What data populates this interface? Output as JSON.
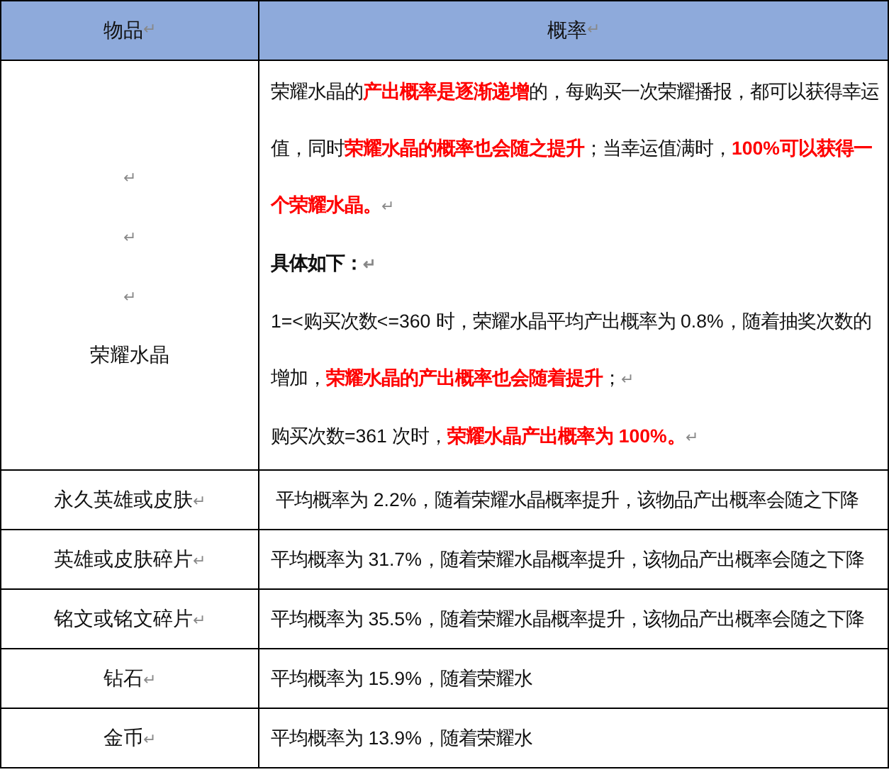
{
  "table": {
    "columns": [
      {
        "label": "物品",
        "end_mark": "↵"
      },
      {
        "label": "概率",
        "end_mark": "↵"
      }
    ],
    "rows": [
      {
        "item": [
          {
            "end_mark": "↵"
          },
          {
            "end_mark": "↵"
          },
          {
            "end_mark": "↵"
          },
          {
            "text": "荣耀水晶"
          }
        ],
        "probability": [
          {
            "text": "荣耀水晶的**产出概率是逐渐递增**的，每购买一次荣耀播报，都可以获得幸运值，同时**荣耀水晶的概率也会随之提升**；当幸运值满时，**100%可以获得一个荣耀水晶。**",
            "end_mark": "↵"
          },
          {
            "text": "具体如下：",
            "bold": true,
            "end_mark": "↵"
          },
          {
            "text": "1=<购买次数<=360 时，荣耀水晶平均产出概率为 0.8%，随着抽奖次数的增加，**荣耀水晶的产出概率也会随着提升**；",
            "end_mark": "↵"
          },
          {
            "text": "购买次数=361 次时，**荣耀水晶产出概率为 100%。**",
            "end_mark": "↵"
          }
        ]
      },
      {
        "item": [
          {
            "text": "永久英雄或皮肤",
            "end_mark": "↵"
          }
        ],
        "probability": [
          {
            "text": " 平均概率为 2.2%，随着荣耀水晶概率提升，该物品产出概率会随之下降"
          }
        ]
      },
      {
        "item": [
          {
            "text": "英雄或皮肤碎片",
            "end_mark": "↵"
          }
        ],
        "probability": [
          {
            "text": "平均概率为 31.7%，随着荣耀水晶概率提升，该物品产出概率会随之下降"
          }
        ]
      },
      {
        "item": [
          {
            "text": "铭文或铭文碎片",
            "end_mark": "↵"
          }
        ],
        "probability": [
          {
            "text": "平均概率为 35.5%，随着荣耀水晶概率提升，该物品产出概率会随之下降"
          }
        ]
      },
      {
        "item": [
          {
            "text": "钻石",
            "end_mark": "↵"
          }
        ],
        "probability": [
          {
            "text": "平均概率为 15.9%，随着荣耀水"
          }
        ]
      },
      {
        "item": [
          {
            "text": "金币",
            "end_mark": "↵"
          }
        ],
        "probability": [
          {
            "text": "平均概率为 13.9%，随着荣耀水"
          }
        ]
      }
    ]
  }
}
